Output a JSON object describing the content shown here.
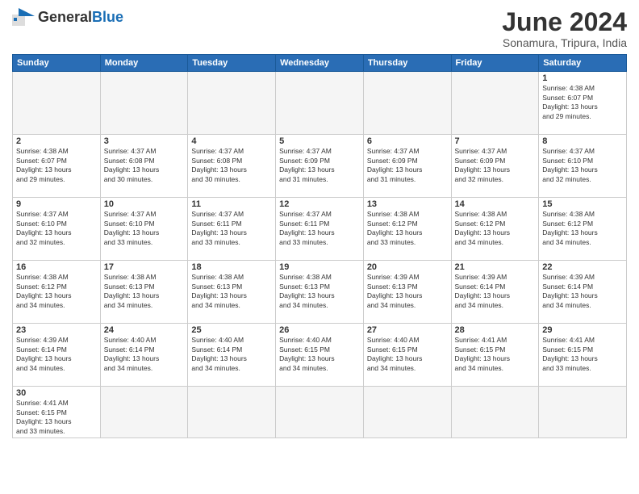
{
  "logo": {
    "text_general": "General",
    "text_blue": "Blue"
  },
  "header": {
    "month": "June 2024",
    "location": "Sonamura, Tripura, India"
  },
  "weekdays": [
    "Sunday",
    "Monday",
    "Tuesday",
    "Wednesday",
    "Thursday",
    "Friday",
    "Saturday"
  ],
  "days": [
    {
      "date": "",
      "info": ""
    },
    {
      "date": "",
      "info": ""
    },
    {
      "date": "",
      "info": ""
    },
    {
      "date": "",
      "info": ""
    },
    {
      "date": "",
      "info": ""
    },
    {
      "date": "",
      "info": ""
    },
    {
      "date": "1",
      "info": "Sunrise: 4:38 AM\nSunset: 6:07 PM\nDaylight: 13 hours\nand 29 minutes."
    },
    {
      "date": "2",
      "info": "Sunrise: 4:38 AM\nSunset: 6:07 PM\nDaylight: 13 hours\nand 29 minutes."
    },
    {
      "date": "3",
      "info": "Sunrise: 4:37 AM\nSunset: 6:08 PM\nDaylight: 13 hours\nand 30 minutes."
    },
    {
      "date": "4",
      "info": "Sunrise: 4:37 AM\nSunset: 6:08 PM\nDaylight: 13 hours\nand 30 minutes."
    },
    {
      "date": "5",
      "info": "Sunrise: 4:37 AM\nSunset: 6:09 PM\nDaylight: 13 hours\nand 31 minutes."
    },
    {
      "date": "6",
      "info": "Sunrise: 4:37 AM\nSunset: 6:09 PM\nDaylight: 13 hours\nand 31 minutes."
    },
    {
      "date": "7",
      "info": "Sunrise: 4:37 AM\nSunset: 6:09 PM\nDaylight: 13 hours\nand 32 minutes."
    },
    {
      "date": "8",
      "info": "Sunrise: 4:37 AM\nSunset: 6:10 PM\nDaylight: 13 hours\nand 32 minutes."
    },
    {
      "date": "9",
      "info": "Sunrise: 4:37 AM\nSunset: 6:10 PM\nDaylight: 13 hours\nand 32 minutes."
    },
    {
      "date": "10",
      "info": "Sunrise: 4:37 AM\nSunset: 6:10 PM\nDaylight: 13 hours\nand 33 minutes."
    },
    {
      "date": "11",
      "info": "Sunrise: 4:37 AM\nSunset: 6:11 PM\nDaylight: 13 hours\nand 33 minutes."
    },
    {
      "date": "12",
      "info": "Sunrise: 4:37 AM\nSunset: 6:11 PM\nDaylight: 13 hours\nand 33 minutes."
    },
    {
      "date": "13",
      "info": "Sunrise: 4:38 AM\nSunset: 6:12 PM\nDaylight: 13 hours\nand 33 minutes."
    },
    {
      "date": "14",
      "info": "Sunrise: 4:38 AM\nSunset: 6:12 PM\nDaylight: 13 hours\nand 34 minutes."
    },
    {
      "date": "15",
      "info": "Sunrise: 4:38 AM\nSunset: 6:12 PM\nDaylight: 13 hours\nand 34 minutes."
    },
    {
      "date": "16",
      "info": "Sunrise: 4:38 AM\nSunset: 6:12 PM\nDaylight: 13 hours\nand 34 minutes."
    },
    {
      "date": "17",
      "info": "Sunrise: 4:38 AM\nSunset: 6:13 PM\nDaylight: 13 hours\nand 34 minutes."
    },
    {
      "date": "18",
      "info": "Sunrise: 4:38 AM\nSunset: 6:13 PM\nDaylight: 13 hours\nand 34 minutes."
    },
    {
      "date": "19",
      "info": "Sunrise: 4:38 AM\nSunset: 6:13 PM\nDaylight: 13 hours\nand 34 minutes."
    },
    {
      "date": "20",
      "info": "Sunrise: 4:39 AM\nSunset: 6:13 PM\nDaylight: 13 hours\nand 34 minutes."
    },
    {
      "date": "21",
      "info": "Sunrise: 4:39 AM\nSunset: 6:14 PM\nDaylight: 13 hours\nand 34 minutes."
    },
    {
      "date": "22",
      "info": "Sunrise: 4:39 AM\nSunset: 6:14 PM\nDaylight: 13 hours\nand 34 minutes."
    },
    {
      "date": "23",
      "info": "Sunrise: 4:39 AM\nSunset: 6:14 PM\nDaylight: 13 hours\nand 34 minutes."
    },
    {
      "date": "24",
      "info": "Sunrise: 4:40 AM\nSunset: 6:14 PM\nDaylight: 13 hours\nand 34 minutes."
    },
    {
      "date": "25",
      "info": "Sunrise: 4:40 AM\nSunset: 6:14 PM\nDaylight: 13 hours\nand 34 minutes."
    },
    {
      "date": "26",
      "info": "Sunrise: 4:40 AM\nSunset: 6:15 PM\nDaylight: 13 hours\nand 34 minutes."
    },
    {
      "date": "27",
      "info": "Sunrise: 4:40 AM\nSunset: 6:15 PM\nDaylight: 13 hours\nand 34 minutes."
    },
    {
      "date": "28",
      "info": "Sunrise: 4:41 AM\nSunset: 6:15 PM\nDaylight: 13 hours\nand 34 minutes."
    },
    {
      "date": "29",
      "info": "Sunrise: 4:41 AM\nSunset: 6:15 PM\nDaylight: 13 hours\nand 33 minutes."
    },
    {
      "date": "30",
      "info": "Sunrise: 4:41 AM\nSunset: 6:15 PM\nDaylight: 13 hours\nand 33 minutes."
    }
  ]
}
